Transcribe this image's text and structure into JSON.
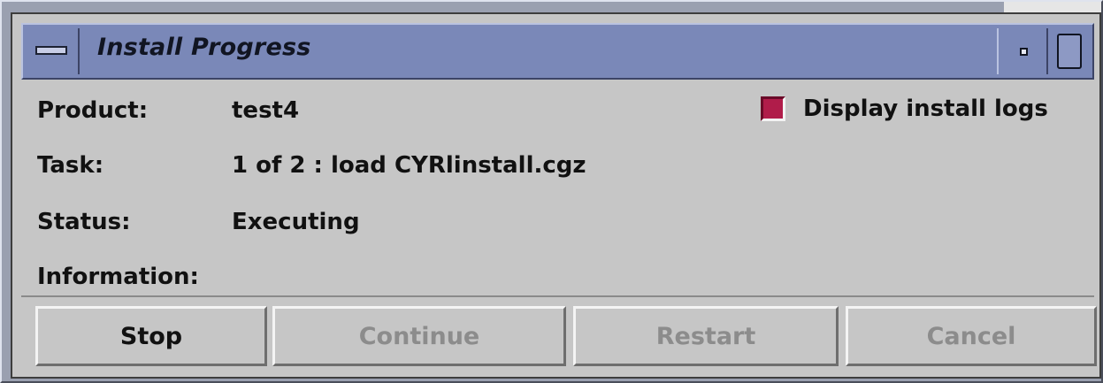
{
  "window": {
    "title": "Install Progress"
  },
  "fields": {
    "product_label": "Product:",
    "product_value": "test4",
    "task_label": "Task:",
    "task_value": "1 of 2 : load CYRlinstall.cgz",
    "status_label": "Status:",
    "status_value": "Executing",
    "information_label": "Information:",
    "information_value": ""
  },
  "options": {
    "display_logs_label": "Display install logs",
    "display_logs_checked": true
  },
  "buttons": {
    "stop": "Stop",
    "continue": "Continue",
    "restart": "Restart",
    "cancel": "Cancel"
  },
  "colors": {
    "titlebar": "#7a88b8",
    "window_bg": "#c6c6c6",
    "checkbox_on": "#b01c4a",
    "disabled_text": "#8c8c8c"
  }
}
